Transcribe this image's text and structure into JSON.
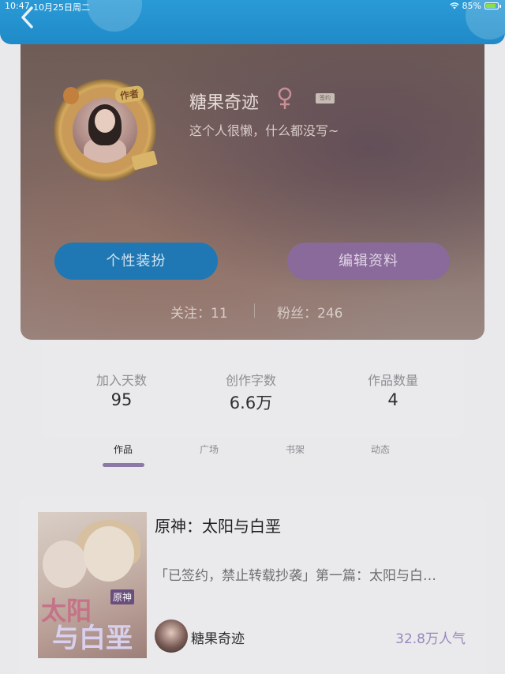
{
  "status_bar": {
    "time": "10:47",
    "date": "10月25日周二",
    "battery": "85%"
  },
  "profile": {
    "avatar_badge": "作者",
    "username": "糖果奇迹",
    "gender_icon": "female-icon",
    "tag": "签约",
    "bio": "这个人很懒，什么都没写~",
    "dress_button": "个性装扮",
    "edit_button": "编辑资料",
    "follow_label": "关注：11",
    "fans_label": "粉丝：246"
  },
  "stats": [
    {
      "label": "加入天数",
      "value": "95"
    },
    {
      "label": "创作字数",
      "value": "6.6万"
    },
    {
      "label": "作品数量",
      "value": "4"
    }
  ],
  "tabs": [
    {
      "label": "作品"
    },
    {
      "label": "广场"
    },
    {
      "label": "书架"
    },
    {
      "label": "动态"
    }
  ],
  "work": {
    "cover_text1": "太阳",
    "cover_text2": "与白垩",
    "cover_tag": "原神",
    "title": "原神：太阳与白垩",
    "description": "「已签约，禁止转载抄袭」第一篇：太阳与白…",
    "author": "糖果奇迹",
    "popularity": "32.8万人气"
  },
  "colors": {
    "header": "#2a9ad6",
    "dress_button": "#1f78b4",
    "edit_button": "#8a6a9a",
    "tab_underline": "#8d79a6",
    "popularity": "#9a86bb"
  }
}
